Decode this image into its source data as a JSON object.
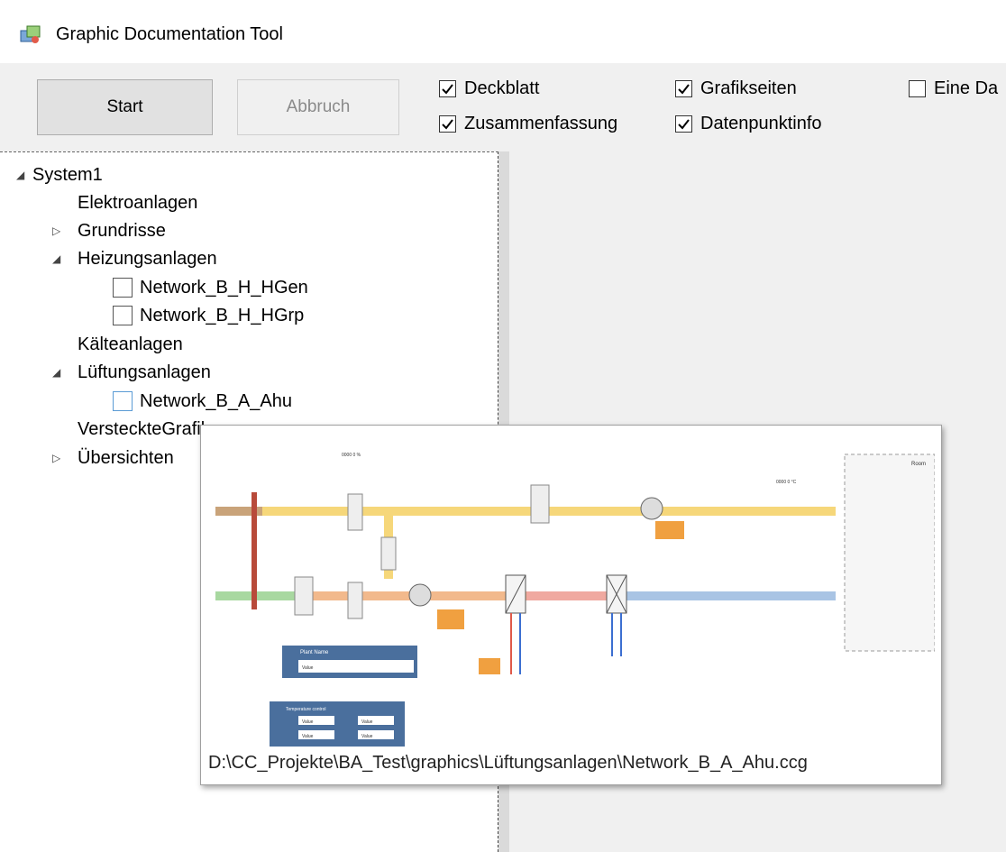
{
  "window": {
    "title": "Graphic Documentation Tool"
  },
  "toolbar": {
    "start_label": "Start",
    "abort_label": "Abbruch"
  },
  "options": [
    {
      "label": "Deckblatt",
      "checked": true
    },
    {
      "label": "Zusammenfassung",
      "checked": true
    },
    {
      "label": "Grafikseiten",
      "checked": true
    },
    {
      "label": "Datenpunktinfo",
      "checked": true
    },
    {
      "label": "Eine Da",
      "checked": false
    }
  ],
  "tree": {
    "root": "System1",
    "items": [
      {
        "label": "Elektroanlagen"
      },
      {
        "label": "Grundrisse"
      },
      {
        "label": "Heizungsanlagen"
      },
      {
        "label": "Network_B_H_HGen"
      },
      {
        "label": "Network_B_H_HGrp"
      },
      {
        "label": "Kälteanlagen"
      },
      {
        "label": "Lüftungsanlagen"
      },
      {
        "label": "Network_B_A_Ahu"
      },
      {
        "label": "VersteckteGrafiken"
      },
      {
        "label": "Übersichten"
      }
    ]
  },
  "preview": {
    "path": "D:\\CC_Projekte\\BA_Test\\graphics\\Lüftungsanlagen\\Network_B_A_Ahu.ccg",
    "thumbnail": {
      "room_label": "Room",
      "plant_name_title": "Plant Name",
      "plant_name_value": "Value",
      "temp_control_title": "Temperature control",
      "temp_values": [
        "Value",
        "Value",
        "Value",
        "Value"
      ],
      "value_readout": "0000 0 %",
      "setpoint_readout": "0000 0 °C"
    }
  },
  "colors": {
    "supply_duct": "#f6d77a",
    "return_duct": "#a9c4e4",
    "outdoor_duct": "#a8d8a0",
    "heated_duct": "#f2b98c",
    "exhaust_duct": "#c9a37a",
    "panel_blue": "#4a6f9d",
    "selection_blue": "#5b9bd5"
  }
}
